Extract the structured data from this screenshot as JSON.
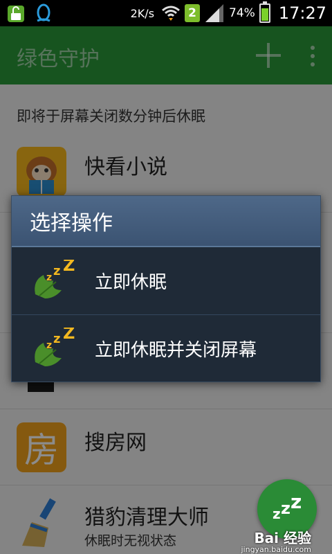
{
  "status_bar": {
    "speed": "2K/s",
    "sim_badge": "2",
    "battery": "74%",
    "battery_level": 0.74,
    "time": "17:27",
    "icons": [
      "unlock-icon",
      "qq-icon",
      "wifi-icon",
      "signal-icon",
      "battery-icon"
    ]
  },
  "app_bar": {
    "title": "绿色守护",
    "add_icon": "plus-icon",
    "more_icon": "overflow-menu-icon"
  },
  "list": {
    "section_label": "即将于屏幕关闭数分钟后休眠",
    "items": [
      {
        "name": "快看小说",
        "icon": "kuaikan-novel-icon"
      },
      {
        "name": "搜房网",
        "icon": "soufang-icon",
        "icon_text": "房"
      },
      {
        "name": "猎豹清理大师",
        "subtitle": "休眠时无视状态",
        "icon": "broom-icon"
      }
    ]
  },
  "dialog": {
    "title": "选择操作",
    "items": [
      {
        "label": "立即休眠",
        "icon": "sleep-leaf-icon"
      },
      {
        "label": "立即休眠并关闭屏幕",
        "icon": "sleep-leaf-icon"
      }
    ]
  },
  "fab": {
    "icon": "sleep-zzz-icon"
  },
  "watermark": {
    "text": "Bai 经验",
    "sub": "jingyan.baidu.com"
  },
  "colors": {
    "app_bar": "#2b9a3a",
    "dialog_bg": "#1f2a37",
    "dialog_title": "#4e6888",
    "fab": "#2a8b36"
  }
}
